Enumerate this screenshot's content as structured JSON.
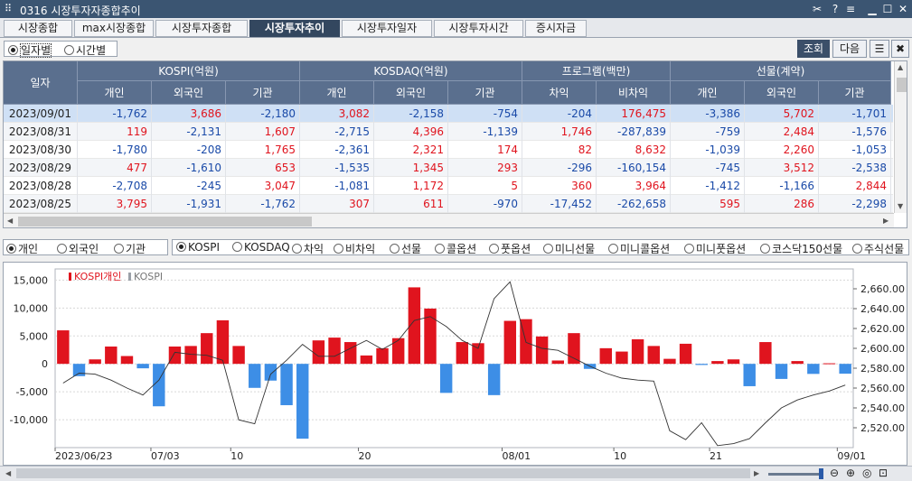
{
  "window": {
    "title": "0316 시장투자자종합추이",
    "icons": [
      "pin-icon",
      "help-icon",
      "menu-icon",
      "minimize-icon",
      "maximize-icon",
      "close-icon"
    ],
    "help_glyph": "?"
  },
  "tabs": [
    "시장종합",
    "max시장종합",
    "시장투자종합",
    "시장투자추이",
    "시장투자일자",
    "시장투자시간",
    "증시자금"
  ],
  "active_tab": 3,
  "view_mode": {
    "options": [
      "일자별",
      "시간별"
    ],
    "selected": 0
  },
  "buttons": {
    "query": "조회",
    "next": "다음"
  },
  "table": {
    "date_header": "일자",
    "groups": [
      {
        "label": "KOSPI(억원)",
        "cols": [
          "개인",
          "외국인",
          "기관"
        ]
      },
      {
        "label": "KOSDAQ(억원)",
        "cols": [
          "개인",
          "외국인",
          "기관"
        ]
      },
      {
        "label": "프로그램(백만)",
        "cols": [
          "차익",
          "비차익"
        ]
      },
      {
        "label": "선물(계약)",
        "cols": [
          "개인",
          "외국인",
          "기관"
        ]
      }
    ],
    "rows": [
      {
        "date": "2023/09/01",
        "values": [
          "-1,762",
          "3,686",
          "-2,180",
          "3,082",
          "-2,158",
          "-754",
          "-204",
          "176,475",
          "-3,386",
          "5,702",
          "-1,701"
        ]
      },
      {
        "date": "2023/08/31",
        "values": [
          "119",
          "-2,131",
          "1,607",
          "-2,715",
          "4,396",
          "-1,139",
          "1,746",
          "-287,839",
          "-759",
          "2,484",
          "-1,576"
        ]
      },
      {
        "date": "2023/08/30",
        "values": [
          "-1,780",
          "-208",
          "1,765",
          "-2,361",
          "2,321",
          "174",
          "82",
          "8,632",
          "-1,039",
          "2,260",
          "-1,053"
        ]
      },
      {
        "date": "2023/08/29",
        "values": [
          "477",
          "-1,610",
          "653",
          "-1,535",
          "1,345",
          "293",
          "-296",
          "-160,154",
          "-745",
          "3,512",
          "-2,538"
        ]
      },
      {
        "date": "2023/08/28",
        "values": [
          "-2,708",
          "-245",
          "3,047",
          "-1,081",
          "1,172",
          "5",
          "360",
          "3,964",
          "-1,412",
          "-1,166",
          "2,844"
        ]
      },
      {
        "date": "2023/08/25",
        "values": [
          "3,795",
          "-1,931",
          "-1,762",
          "307",
          "611",
          "-970",
          "-17,452",
          "-262,658",
          "595",
          "286",
          "-2,298"
        ]
      }
    ],
    "selected_row": 0
  },
  "investor_options": {
    "options": [
      "개인",
      "외국인",
      "기관"
    ],
    "selected": 0
  },
  "market_options": {
    "options": [
      "KOSPI",
      "KOSDAQ",
      "차익",
      "비차익",
      "선물",
      "콜옵션",
      "풋옵션",
      "미니선물",
      "미니콜옵션",
      "미니풋옵션",
      "코스닥150선물",
      "주식선물"
    ],
    "selected": 0
  },
  "chart_data": {
    "type": "bar",
    "legend": [
      {
        "name": "KOSPI개인",
        "color": "#e0141e"
      },
      {
        "name": "KOSPI",
        "color": "#9aa0a8"
      }
    ],
    "colors": {
      "positive": "#e0141e",
      "negative": "#3d8ee6",
      "line": "#333333"
    },
    "left_axis": {
      "min": -15000,
      "max": 17000,
      "ticks": [
        15000,
        10000,
        5000,
        0,
        -5000,
        -10000
      ],
      "tick_labels": [
        "15,000",
        "10,000",
        "5,000",
        "0",
        "-5,000",
        "-10,000"
      ]
    },
    "right_axis": {
      "min": 2500,
      "max": 2680,
      "ticks": [
        2660,
        2640,
        2620,
        2600,
        2580,
        2560,
        2540,
        2520
      ],
      "tick_labels": [
        "2,660.00",
        "2,640.00",
        "2,620.00",
        "2,600.00",
        "2,580.00",
        "2,560.00",
        "2,540.00",
        "2,520.00"
      ]
    },
    "x_labels": [
      {
        "index": 0,
        "text": "2023/06/23"
      },
      {
        "index": 6,
        "text": "07/03"
      },
      {
        "index": 11,
        "text": "10"
      },
      {
        "index": 19,
        "text": "20"
      },
      {
        "index": 28,
        "text": "08/01"
      },
      {
        "index": 35,
        "text": "10"
      },
      {
        "index": 41,
        "text": "21"
      },
      {
        "index": 49,
        "text": "09/01"
      }
    ],
    "series": [
      {
        "name": "KOSPI개인",
        "values": [
          6000,
          -2200,
          800,
          3100,
          1400,
          -800,
          -7600,
          3100,
          3200,
          5500,
          7800,
          3200,
          -4300,
          -3000,
          -7400,
          -13400,
          4200,
          4700,
          3900,
          1500,
          2800,
          4600,
          13700,
          9900,
          -5200,
          3900,
          3700,
          -5600,
          7700,
          8000,
          4900,
          600,
          5500,
          -900,
          2800,
          2200,
          4400,
          3200,
          900,
          3600,
          -200,
          500,
          800,
          -4000,
          3900,
          -2700,
          500,
          -1800,
          100,
          -1762
        ]
      },
      {
        "name": "KOSPI",
        "values": [
          2565,
          2575,
          2574,
          2568,
          2560,
          2553,
          2568,
          2596,
          2594,
          2593,
          2588,
          2528,
          2524,
          2574,
          2588,
          2604,
          2592,
          2592,
          2600,
          2608,
          2599,
          2608,
          2628,
          2632,
          2622,
          2608,
          2600,
          2650,
          2667,
          2606,
          2600,
          2598,
          2590,
          2582,
          2575,
          2570,
          2568,
          2567,
          2517,
          2508,
          2525,
          2502,
          2504,
          2509,
          2525,
          2540,
          2548,
          2553,
          2557,
          2563
        ]
      }
    ]
  },
  "bottom_icons": [
    "zoom-out-icon",
    "zoom-in-icon",
    "zoom-reset-icon",
    "zoom-fit-icon"
  ]
}
